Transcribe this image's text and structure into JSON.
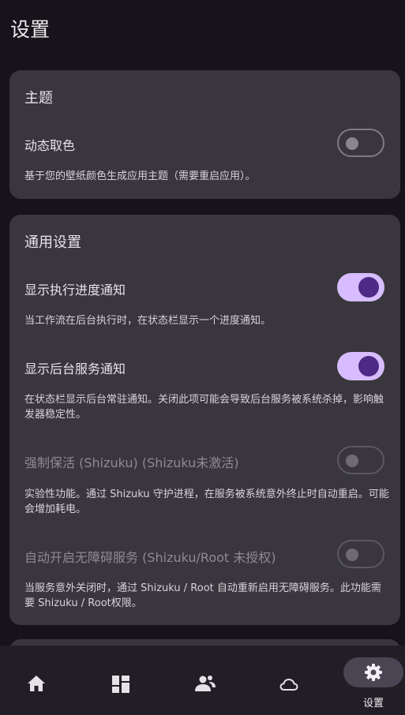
{
  "page": {
    "title": "设置"
  },
  "theme_section": {
    "title": "主题",
    "dynamic_color": {
      "label": "动态取色",
      "description": "基于您的壁纸颜色生成应用主题（需要重启应用）。",
      "enabled": false
    }
  },
  "general_section": {
    "title": "通用设置",
    "items": [
      {
        "label": "显示执行进度通知",
        "description": "当工作流在后台执行时，在状态栏显示一个进度通知。",
        "enabled": true,
        "disabled": false
      },
      {
        "label": "显示后台服务通知",
        "description": "在状态栏显示后台常驻通知。关闭此项可能会导致后台服务被系统杀掉，影响触发器稳定性。",
        "enabled": true,
        "disabled": false
      },
      {
        "label": "强制保活 (Shizuku) (Shizuku未激活)",
        "description": "实验性功能。通过 Shizuku 守护进程，在服务被系统意外终止时自动重启。可能会增加耗电。",
        "enabled": false,
        "disabled": true
      },
      {
        "label": "自动开启无障碍服务 (Shizuku/Root 未授权)",
        "description": "当服务意外关闭时，通过 Shizuku / Root 自动重新启用无障碍服务。此功能需要 Shizuku / Root权限。",
        "enabled": false,
        "disabled": true
      }
    ]
  },
  "bottom_nav": {
    "items": [
      {
        "icon": "home-icon"
      },
      {
        "icon": "dashboard-icon"
      },
      {
        "icon": "people-icon"
      },
      {
        "icon": "cloud-icon"
      },
      {
        "icon": "settings-icon",
        "label": "设置",
        "selected": true
      }
    ]
  },
  "colors": {
    "accent": "#d7bcff",
    "knob_on": "#4c2a85",
    "card": "#39373d",
    "background": "#16141a"
  }
}
